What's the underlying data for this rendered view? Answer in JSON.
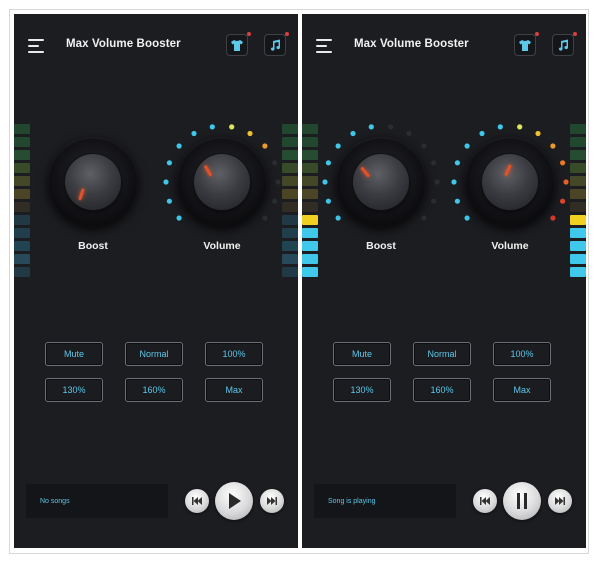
{
  "app": {
    "title": "Max Volume Booster"
  },
  "icons": {
    "menu": "hamburger-menu-icon",
    "theme": "shirt-icon",
    "music": "music-note-icon",
    "prev": "skip-previous-icon",
    "next": "skip-next-icon",
    "play": "play-icon",
    "pause": "pause-icon"
  },
  "colors": {
    "accent": "#5cc8ea",
    "pointer": "#e0522a",
    "background": "#1c1d21"
  },
  "screens": [
    {
      "boost_label": "Boost",
      "volume_label": "Volume",
      "presets": [
        "Mute",
        "Normal",
        "100%",
        "130%",
        "160%",
        "Max"
      ],
      "song_text": "No songs",
      "playback_state": "paused"
    },
    {
      "boost_label": "Boost",
      "volume_label": "Volume",
      "presets": [
        "Mute",
        "Normal",
        "100%",
        "130%",
        "160%",
        "Max"
      ],
      "song_text": "Song is playing",
      "playback_state": "playing"
    }
  ]
}
